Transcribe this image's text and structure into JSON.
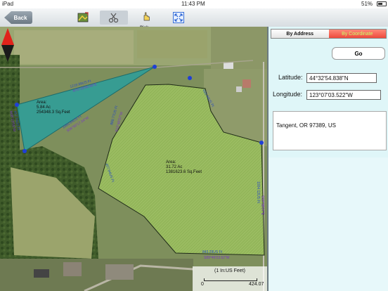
{
  "status_bar": {
    "device": "iPad",
    "time": "11:43 PM",
    "battery": "51%"
  },
  "toolbar": {
    "back_label": "Back",
    "pick_label": "Pick",
    "icons": [
      "map-layer-icon",
      "scissors-icon",
      "pick-hand-icon",
      "fullscreen-icon"
    ]
  },
  "map": {
    "triangle_area": {
      "title": "Area:",
      "acres": "5.84 Ac",
      "sqfeet": "254348.3 Sq.Feet"
    },
    "field_area": {
      "title": "Area:",
      "acres": "31.72 Ac",
      "sqfeet": "1381623.6 Sq.Feet"
    },
    "scale": {
      "title": "(1 In:US Feet)",
      "zero": "0",
      "end": "424.07"
    },
    "polygon_colors": {
      "triangle_fill": "#2e9e9a",
      "field_fill": "#93b65a"
    }
  },
  "panel": {
    "tab_by_address": "By Address",
    "tab_by_coordinate": "By Coordinate",
    "go_label": "Go",
    "latitude_label": "Latitude:",
    "latitude_value": "44°32'54.838\"N",
    "longitude_label": "Longitude:",
    "longitude_value": "123°07'03.522\"W",
    "address": "Tangent, OR  97389, US"
  }
}
